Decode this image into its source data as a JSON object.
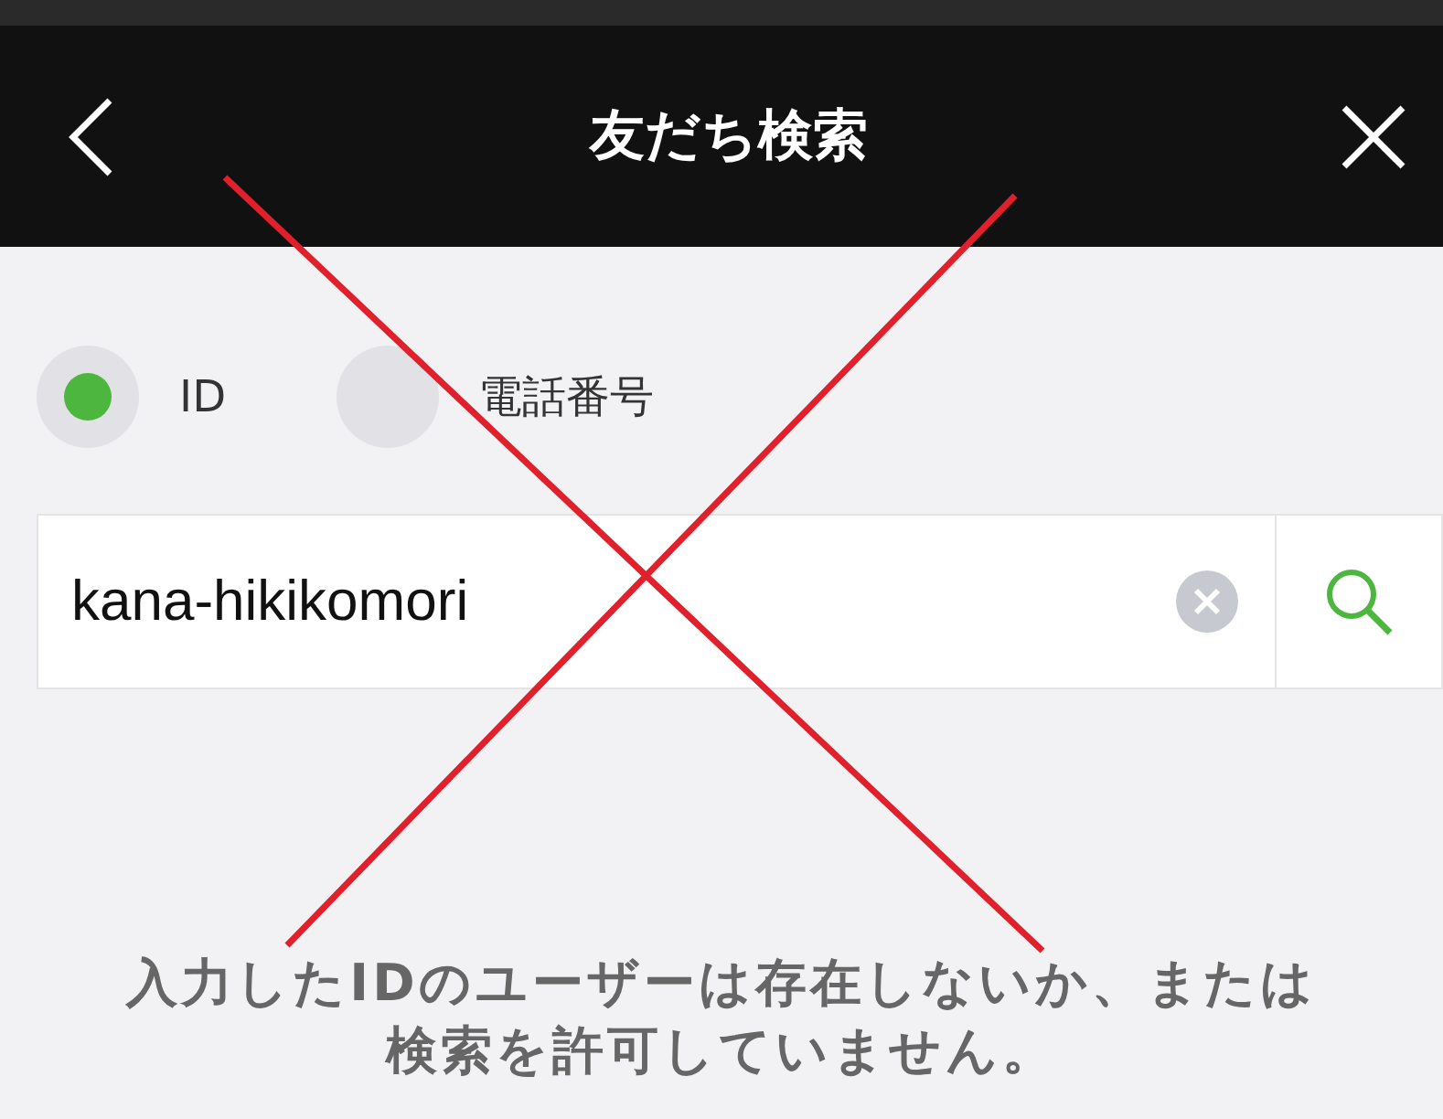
{
  "header": {
    "title": "友だち検索"
  },
  "search_types": [
    {
      "label": "ID",
      "selected": true
    },
    {
      "label": "電話番号",
      "selected": false
    }
  ],
  "search": {
    "value": "kana-hikikomori"
  },
  "message": "入力したIDのユーザーは存在しないか、または検索を許可していません。"
}
